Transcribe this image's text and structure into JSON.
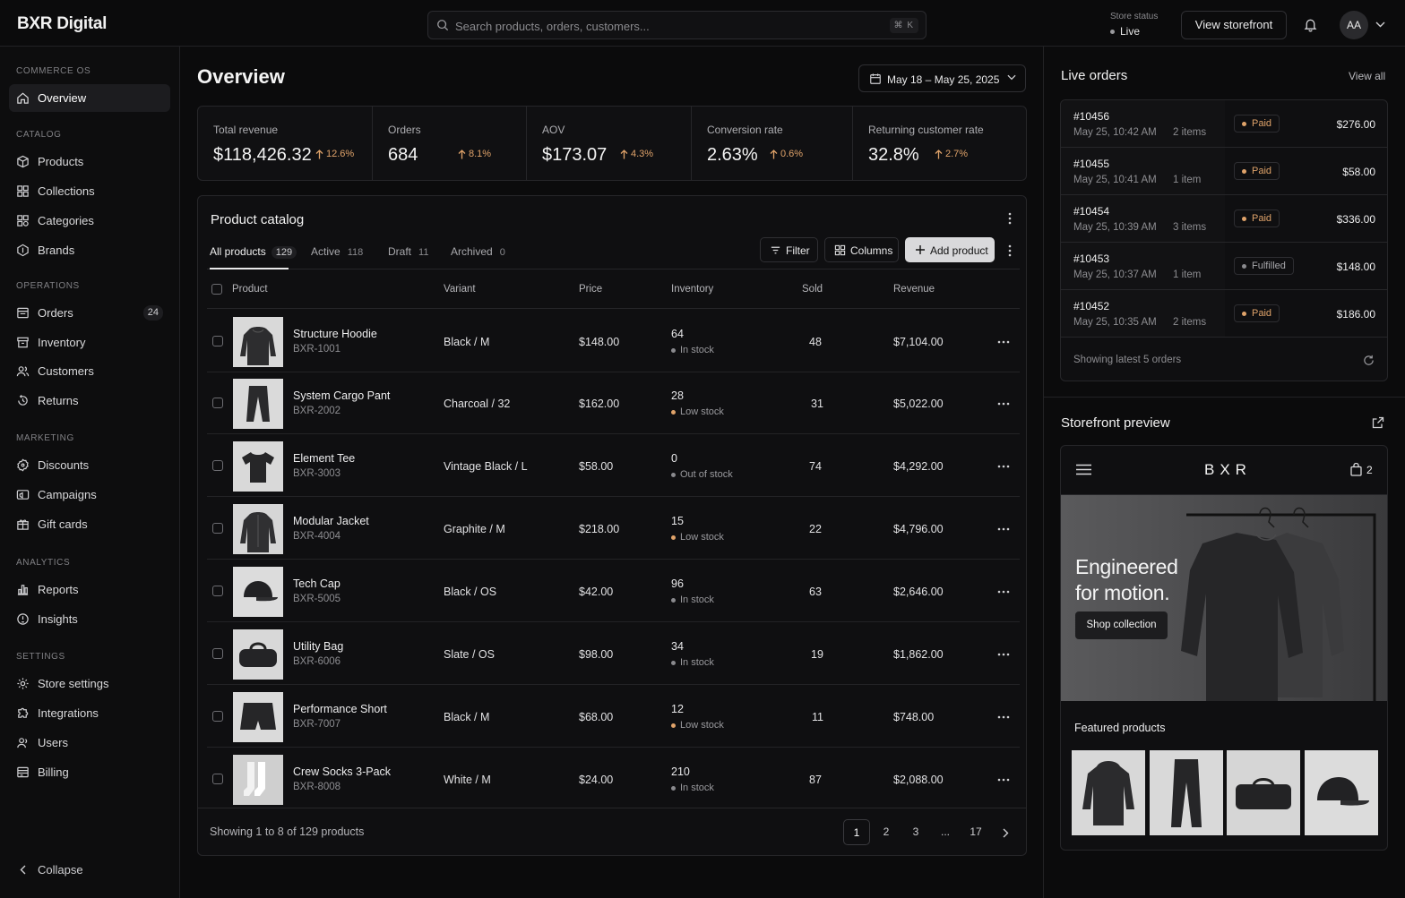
{
  "app": {
    "brand": "BXR Digital"
  },
  "topbar": {
    "search_placeholder": "Search products, orders, customers...",
    "search_shortcut": "⌘ K",
    "store_status_label": "Store status",
    "store_status_value": "Live",
    "view_storefront": "View storefront",
    "avatar_initials": "AA"
  },
  "sidebar": {
    "sections": {
      "commerce": "COMMERCE OS",
      "catalog": "CATALOG",
      "operations": "OPERATIONS",
      "marketing": "MARKETING",
      "analytics": "ANALYTICS",
      "settings": "SETTINGS"
    },
    "items": {
      "overview": "Overview",
      "products": "Products",
      "collections": "Collections",
      "categories": "Categories",
      "brands": "Brands",
      "orders": "Orders",
      "orders_badge": "24",
      "inventory": "Inventory",
      "customers": "Customers",
      "returns": "Returns",
      "discounts": "Discounts",
      "campaigns": "Campaigns",
      "giftcards": "Gift cards",
      "reports": "Reports",
      "insights": "Insights",
      "store_settings": "Store settings",
      "integrations": "Integrations",
      "users": "Users",
      "billing": "Billing"
    },
    "collapse": "Collapse"
  },
  "main": {
    "title": "Overview",
    "date_range": "May 18 – May 25, 2025",
    "kpis": [
      {
        "label": "Total revenue",
        "value": "$118,426.32",
        "delta": "12.6%"
      },
      {
        "label": "Orders",
        "value": "684",
        "delta": "8.1%"
      },
      {
        "label": "AOV",
        "value": "$173.07",
        "delta": "4.3%"
      },
      {
        "label": "Conversion rate",
        "value": "2.63%",
        "delta": "0.6%"
      },
      {
        "label": "Returning customer rate",
        "value": "32.8%",
        "delta": "2.7%"
      }
    ]
  },
  "catalog": {
    "title": "Product catalog",
    "tabs": [
      {
        "label": "All products",
        "count": "129"
      },
      {
        "label": "Active",
        "count": "118"
      },
      {
        "label": "Draft",
        "count": "11"
      },
      {
        "label": "Archived",
        "count": "0"
      }
    ],
    "filter": "Filter",
    "columns": "Columns",
    "add_product": "Add product",
    "headers": {
      "product": "Product",
      "variant": "Variant",
      "price": "Price",
      "inventory": "Inventory",
      "sold": "Sold",
      "revenue": "Revenue"
    },
    "rows": [
      {
        "name": "Structure Hoodie",
        "sku": "BXR-1001",
        "variant": "Black / M",
        "price": "$148.00",
        "qty": "64",
        "stock": "In stock",
        "sold": "48",
        "revenue": "$7,104.00"
      },
      {
        "name": "System Cargo Pant",
        "sku": "BXR-2002",
        "variant": "Charcoal / 32",
        "price": "$162.00",
        "qty": "28",
        "stock": "Low stock",
        "sold": "31",
        "revenue": "$5,022.00"
      },
      {
        "name": "Element Tee",
        "sku": "BXR-3003",
        "variant": "Vintage Black / L",
        "price": "$58.00",
        "qty": "0",
        "stock": "Out of stock",
        "sold": "74",
        "revenue": "$4,292.00"
      },
      {
        "name": "Modular Jacket",
        "sku": "BXR-4004",
        "variant": "Graphite / M",
        "price": "$218.00",
        "qty": "15",
        "stock": "Low stock",
        "sold": "22",
        "revenue": "$4,796.00"
      },
      {
        "name": "Tech Cap",
        "sku": "BXR-5005",
        "variant": "Black / OS",
        "price": "$42.00",
        "qty": "96",
        "stock": "In stock",
        "sold": "63",
        "revenue": "$2,646.00"
      },
      {
        "name": "Utility Bag",
        "sku": "BXR-6006",
        "variant": "Slate / OS",
        "price": "$98.00",
        "qty": "34",
        "stock": "In stock",
        "sold": "19",
        "revenue": "$1,862.00"
      },
      {
        "name": "Performance Short",
        "sku": "BXR-7007",
        "variant": "Black / M",
        "price": "$68.00",
        "qty": "12",
        "stock": "Low stock",
        "sold": "11",
        "revenue": "$748.00"
      },
      {
        "name": "Crew Socks 3-Pack",
        "sku": "BXR-8008",
        "variant": "White / M",
        "price": "$24.00",
        "qty": "210",
        "stock": "In stock",
        "sold": "87",
        "revenue": "$2,088.00"
      }
    ],
    "footer": "Showing 1 to 8 of 129 products",
    "pages": [
      "1",
      "2",
      "3",
      "...",
      "17"
    ]
  },
  "live_orders": {
    "title": "Live orders",
    "view_all": "View all",
    "orders": [
      {
        "id": "#10456",
        "date": "May 25, 10:42 AM",
        "items": "2 items",
        "status": "Paid",
        "amount": "$276.00"
      },
      {
        "id": "#10455",
        "date": "May 25, 10:41 AM",
        "items": "1 item",
        "status": "Paid",
        "amount": "$58.00"
      },
      {
        "id": "#10454",
        "date": "May 25, 10:39 AM",
        "items": "3 items",
        "status": "Paid",
        "amount": "$336.00"
      },
      {
        "id": "#10453",
        "date": "May 25, 10:37 AM",
        "items": "1 item",
        "status": "Fulfilled",
        "amount": "$148.00"
      },
      {
        "id": "#10452",
        "date": "May 25, 10:35 AM",
        "items": "2 items",
        "status": "Paid",
        "amount": "$186.00"
      }
    ],
    "footer": "Showing latest 5 orders"
  },
  "storefront": {
    "title": "Storefront preview",
    "logo": "BXR",
    "cart_count": "2",
    "hero_line1": "Engineered",
    "hero_line2": "for motion.",
    "cta": "Shop collection",
    "featured": "Featured products"
  },
  "colors": {
    "accent": "#e0a36a",
    "background": "#0b0b0c",
    "panel": "#0f0f11",
    "border": "#262629",
    "neutral_status": "#8a8a8e"
  },
  "icons": [
    "search-icon",
    "bell-icon",
    "chevron-down-icon",
    "home-icon",
    "box-icon",
    "grid-icon",
    "tag-icon",
    "shield-icon",
    "receipt-icon",
    "layers-icon",
    "users-icon",
    "return-icon",
    "discount-icon",
    "megaphone-icon",
    "gift-icon",
    "bar-chart-icon",
    "lightbulb-icon",
    "gear-icon",
    "puzzle-icon",
    "user-icon",
    "card-icon",
    "calendar-icon",
    "filter-icon",
    "columns-icon",
    "plus-icon",
    "more-icon",
    "refresh-icon",
    "external-link-icon",
    "menu-icon",
    "bag-icon"
  ]
}
